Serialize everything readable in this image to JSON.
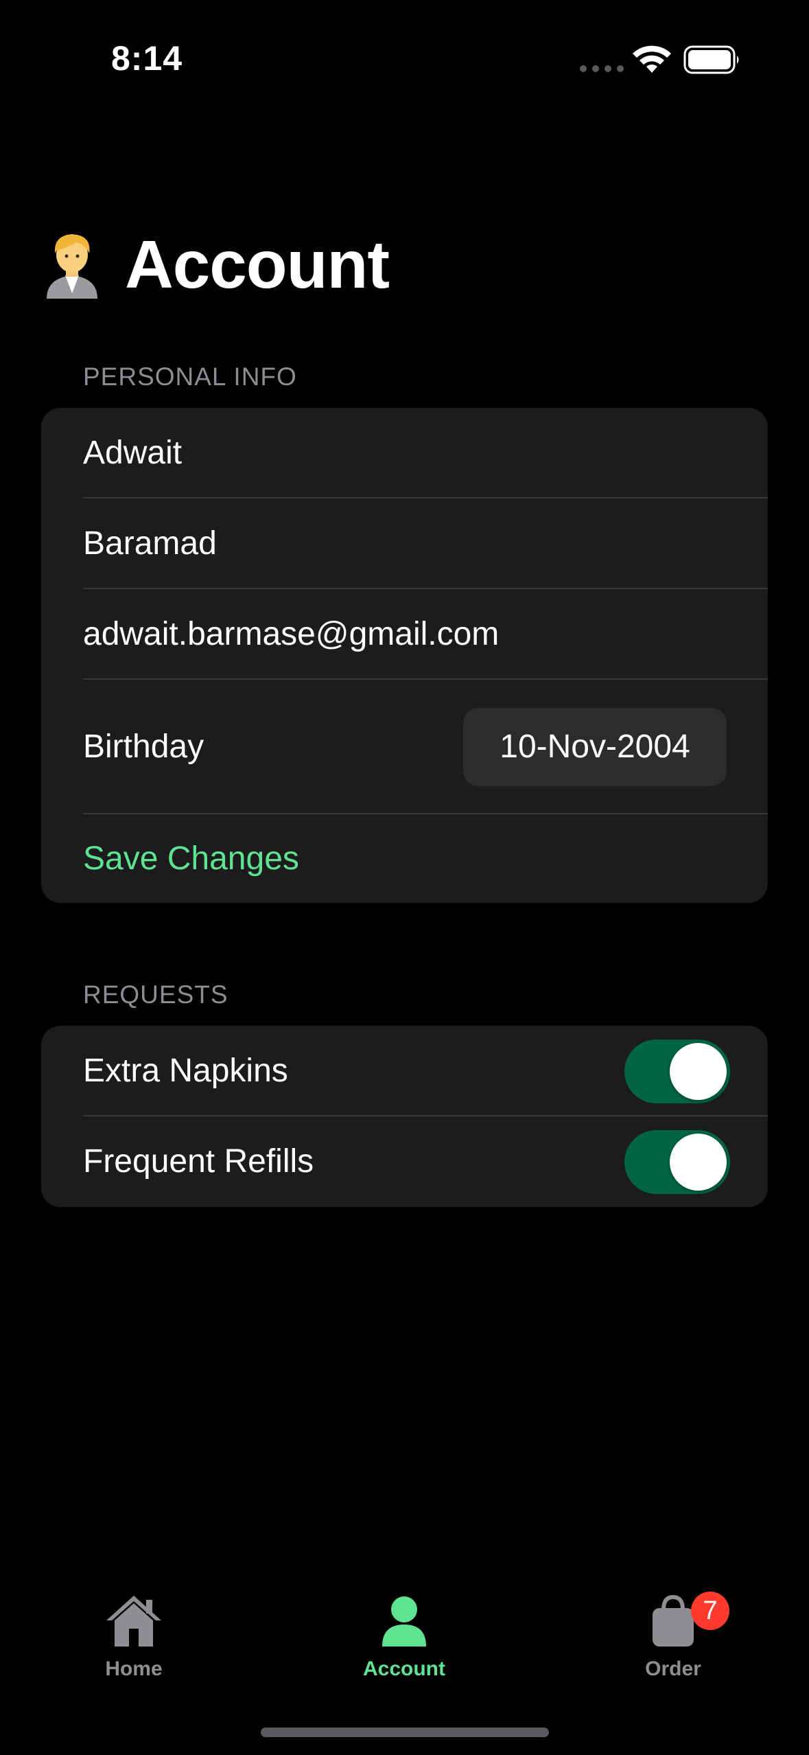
{
  "status_bar": {
    "time": "8:14"
  },
  "header": {
    "emoji_icon": "person-blond-icon",
    "title": "Account"
  },
  "personal_info": {
    "section_title": "PERSONAL INFO",
    "first_name": "Adwait",
    "last_name": "Baramad",
    "email": "adwait.barmase@gmail.com",
    "birthday_label": "Birthday",
    "birthday_value": "10-Nov-2004",
    "save_label": "Save Changes"
  },
  "requests": {
    "section_title": "REQUESTS",
    "items": [
      {
        "label": "Extra Napkins",
        "enabled": true
      },
      {
        "label": "Frequent Refills",
        "enabled": true
      }
    ]
  },
  "tab_bar": {
    "tabs": [
      {
        "label": "Home",
        "icon": "house-icon",
        "active": false
      },
      {
        "label": "Account",
        "icon": "person-icon",
        "active": true
      },
      {
        "label": "Order",
        "icon": "bag-icon",
        "active": false,
        "badge": "7"
      }
    ]
  },
  "colors": {
    "accent": "#5fe391",
    "toggle_on": "#006642",
    "badge": "#ff3b30",
    "card": "#1c1c1e"
  }
}
